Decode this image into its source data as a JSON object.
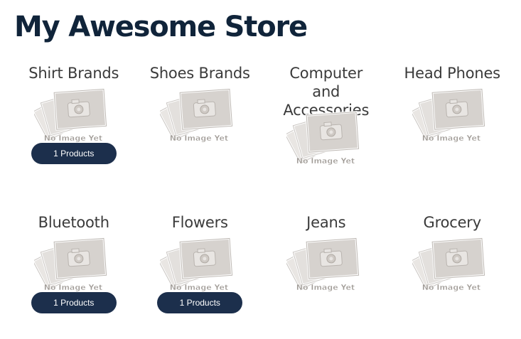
{
  "store": {
    "title": "My Awesome Store"
  },
  "placeholder_text": "No Image Yet",
  "colors": {
    "title": "#10243a",
    "badge": "#1c2f4c",
    "badge_text": "#ffffff"
  },
  "categories": [
    {
      "name": "Shirt Brands",
      "count_label": "1 Products"
    },
    {
      "name": "Shoes Brands",
      "count_label": ""
    },
    {
      "name": "Computer and Accessories",
      "count_label": ""
    },
    {
      "name": "Head Phones",
      "count_label": ""
    },
    {
      "name": "Bluetooth",
      "count_label": "1 Products"
    },
    {
      "name": "Flowers",
      "count_label": "1 Products"
    },
    {
      "name": "Jeans",
      "count_label": ""
    },
    {
      "name": "Grocery",
      "count_label": ""
    }
  ]
}
